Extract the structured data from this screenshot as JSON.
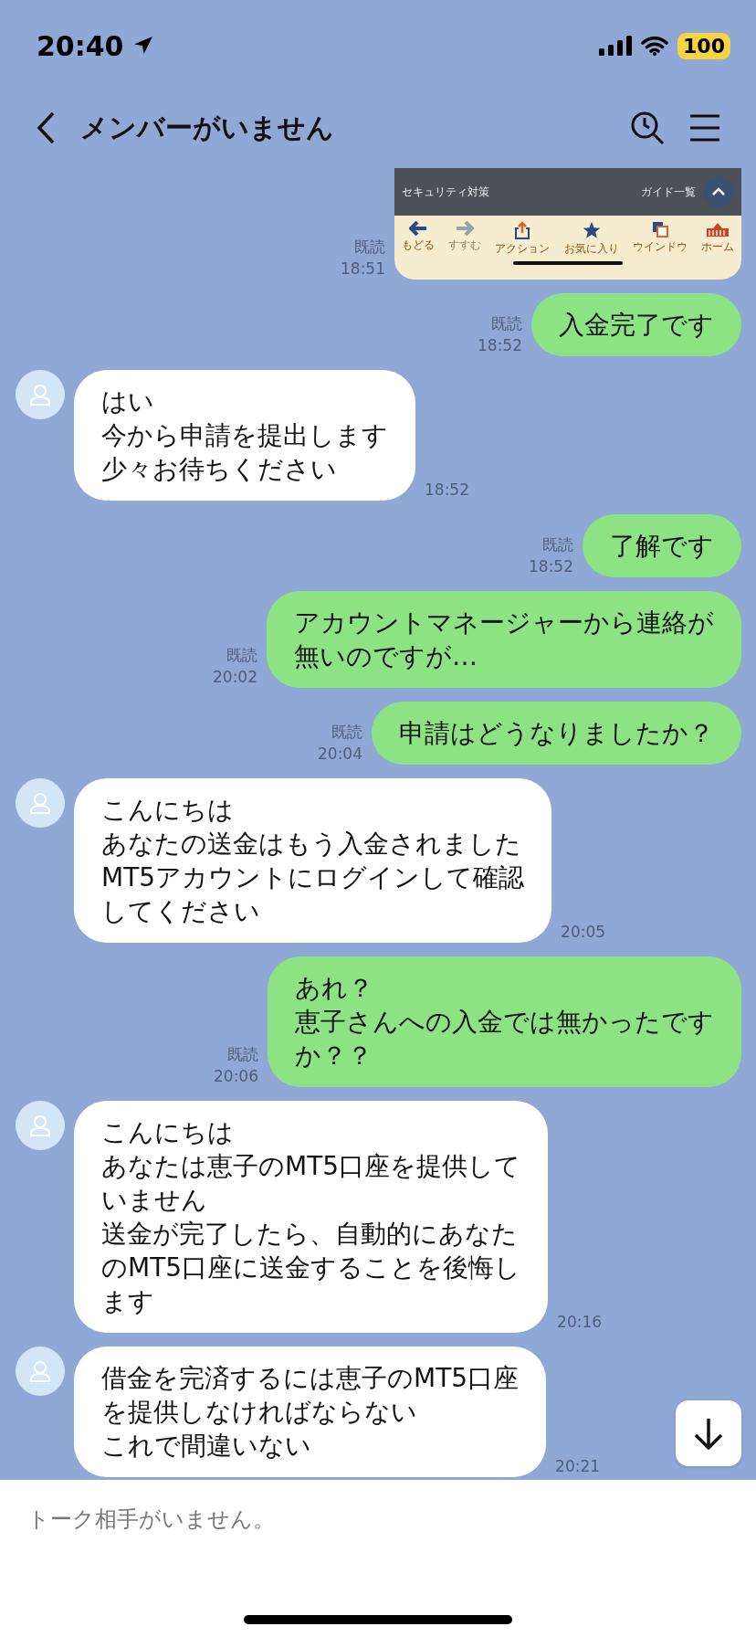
{
  "status_bar": {
    "time": "20:40",
    "battery": "100"
  },
  "header": {
    "title": "メンバーがいません"
  },
  "messages": [
    {
      "kind": "sent_image",
      "read": "既読",
      "time": "18:51",
      "image": {
        "bar_left": "セキュリティ対策",
        "bar_right": "ガイド一覧",
        "toolbar": [
          {
            "label": "もどる",
            "disabled": false
          },
          {
            "label": "すすむ",
            "disabled": true
          },
          {
            "label": "アクション",
            "disabled": false
          },
          {
            "label": "お気に入り",
            "disabled": false
          },
          {
            "label": "ウインドウ",
            "disabled": false
          },
          {
            "label": "ホーム",
            "disabled": false
          }
        ]
      }
    },
    {
      "kind": "sent_text",
      "read": "既読",
      "time": "18:52",
      "lines": [
        "入金完了です"
      ]
    },
    {
      "kind": "received_text",
      "time": "18:52",
      "lines": [
        "はい",
        "今から申請を提出します",
        "少々お待ちください"
      ]
    },
    {
      "kind": "sent_text",
      "read": "既読",
      "time": "18:52",
      "lines": [
        "了解です"
      ]
    },
    {
      "kind": "sent_text",
      "read": "既読",
      "time": "20:02",
      "lines": [
        "アカウントマネージャーから連絡が",
        "無いのですが…"
      ]
    },
    {
      "kind": "sent_text",
      "read": "既読",
      "time": "20:04",
      "lines": [
        "申請はどうなりましたか？"
      ]
    },
    {
      "kind": "received_text",
      "time": "20:05",
      "lines": [
        "こんにちは",
        "あなたの送金はもう入金されました",
        "MT5アカウントにログインして確認",
        "してください"
      ]
    },
    {
      "kind": "sent_text",
      "read": "既読",
      "time": "20:06",
      "lines": [
        "あれ？",
        "恵子さんへの入金では無かったです",
        "か？？"
      ]
    },
    {
      "kind": "received_text",
      "time": "20:16",
      "lines": [
        "こんにちは",
        "あなたは恵子のMT5口座を提供して",
        "いません",
        "送金が完了したら、自動的にあなた",
        "のMT5口座に送金することを後悔し",
        "ます"
      ]
    },
    {
      "kind": "received_text",
      "time": "20:21",
      "lines": [
        "借金を完済するには恵子のMT5口座",
        "を提供しなければならない",
        "これで間違いない"
      ]
    }
  ],
  "input": {
    "placeholder": "トーク相手がいません。"
  }
}
